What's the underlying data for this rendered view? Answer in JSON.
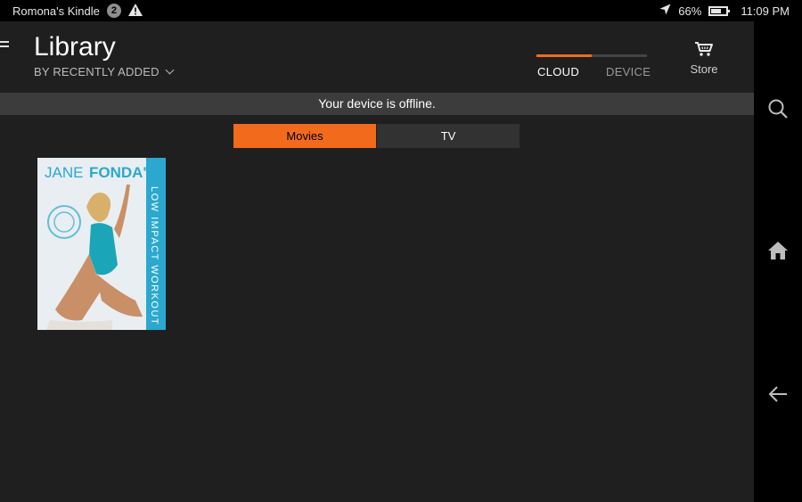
{
  "status_bar": {
    "device_name": "Romona's Kindle",
    "notification_count": "2",
    "battery_percent": "66%",
    "battery_level": 0.66,
    "time": "11:09 PM"
  },
  "header": {
    "title": "Library",
    "sort_label": "BY RECENTLY ADDED",
    "tabs": [
      {
        "label": "CLOUD",
        "selected": true
      },
      {
        "label": "DEVICE",
        "selected": false
      }
    ],
    "store_label": "Store"
  },
  "banner": {
    "message": "Your device is offline."
  },
  "content_tabs": [
    {
      "label": "Movies",
      "selected": true
    },
    {
      "label": "TV",
      "selected": false
    }
  ],
  "library_items": [
    {
      "title_line1": "JANE",
      "title_line2": "FONDA'S",
      "subtitle": "LOW IMPACT WORKOUT"
    }
  ],
  "colors": {
    "accent": "#f26b1d",
    "panel": "#1f1f1f",
    "banner": "#3c3c3c"
  },
  "icons": {
    "menu": "menu-icon",
    "warning": "warning-icon",
    "location": "location-arrow-icon",
    "cart": "cart-icon",
    "search": "search-icon",
    "home": "home-icon",
    "back": "back-arrow-icon"
  }
}
